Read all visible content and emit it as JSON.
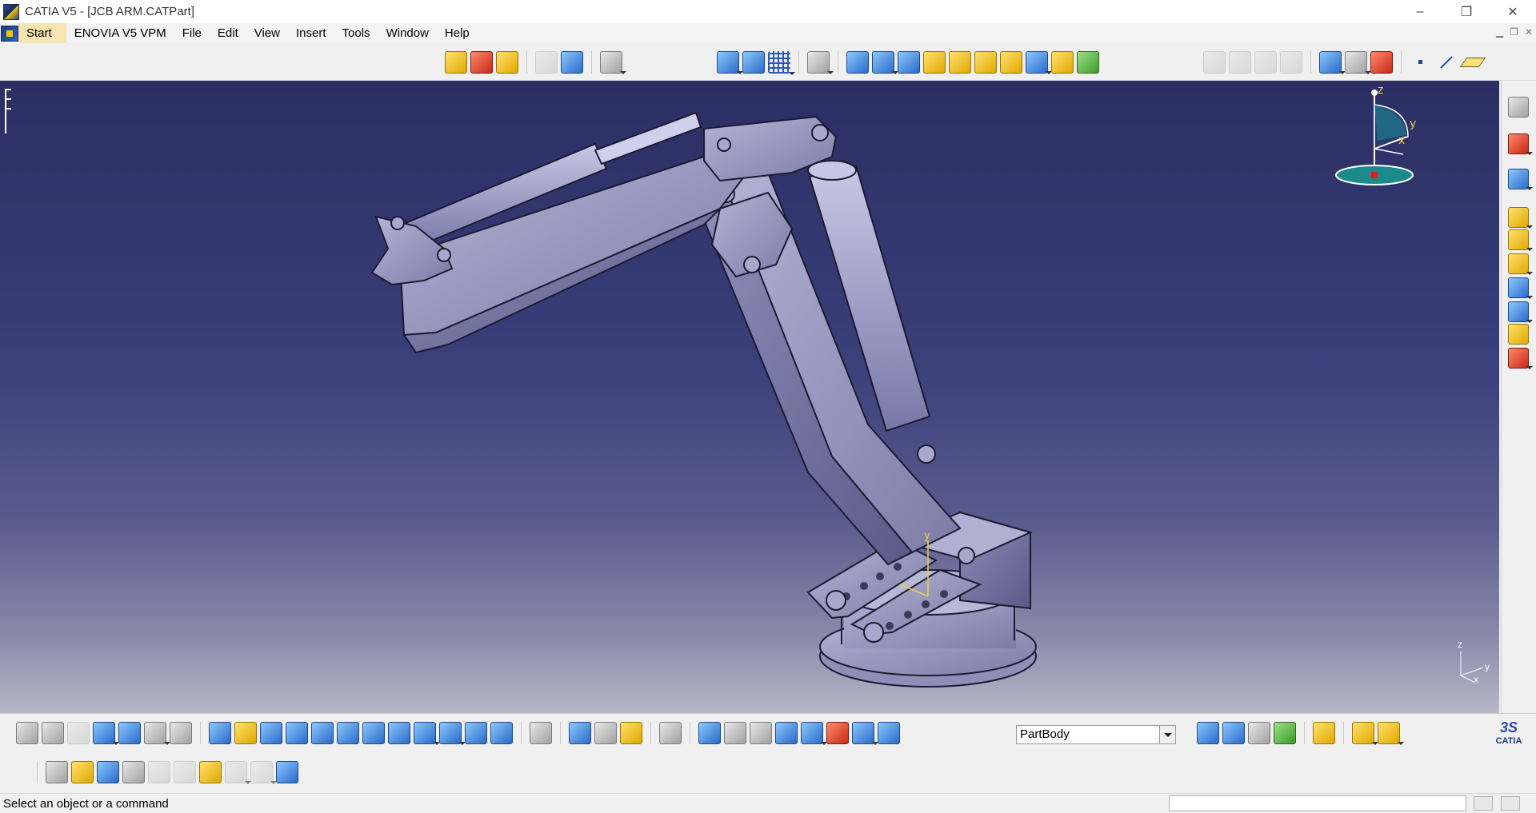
{
  "window": {
    "title": "CATIA V5 - [JCB ARM.CATPart]",
    "controls": {
      "minimize": "–",
      "restore": "❐",
      "close": "✕"
    }
  },
  "menubar": {
    "items": [
      {
        "label": "Start"
      },
      {
        "label": "ENOVIA V5 VPM"
      },
      {
        "label": "File"
      },
      {
        "label": "Edit"
      },
      {
        "label": "View"
      },
      {
        "label": "Insert"
      },
      {
        "label": "Tools"
      },
      {
        "label": "Window"
      },
      {
        "label": "Help"
      }
    ]
  },
  "viewport": {
    "background_top": "#2a2e63",
    "background_bottom": "#b7b7c8",
    "model_name": "JCB ARM",
    "compass_axes": {
      "z": "z",
      "y": "y",
      "x": "x"
    },
    "mini_axes": {
      "z": "z",
      "y": "y",
      "x": "x"
    },
    "part_axes": {
      "y": "y"
    }
  },
  "bottom_toolbar": {
    "body_select": "PartBody",
    "logo_ds": "3S",
    "logo_text": "CATIA"
  },
  "statusbar": {
    "message": "Select an object or a command"
  },
  "colors": {
    "accent_start_menu": "#f8e4b0",
    "model_metal": "#9c9cc4",
    "compass_yellow": "#f2d23a"
  }
}
